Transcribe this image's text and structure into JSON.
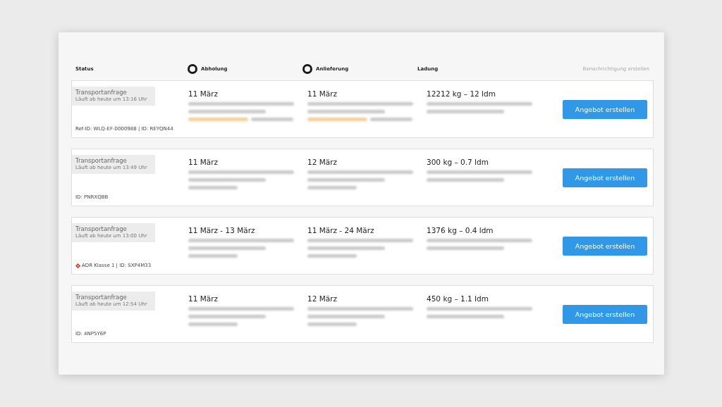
{
  "header": {
    "columns": [
      {
        "label": "Status",
        "kind": "plain"
      },
      {
        "label": "Abholung",
        "kind": "marker"
      },
      {
        "label": "Anlieferung",
        "kind": "marker"
      },
      {
        "label": "Ladung",
        "kind": "plain"
      }
    ],
    "action": "Benachrichtigung erstellen"
  },
  "requests": [
    {
      "status": "Transportanfrage",
      "expires": "Läuft ab heute um 13:16 Uhr",
      "hazard": false,
      "reference": "Ref-ID: WLQ-EF-0000988 | ID: REYQN44",
      "pickup": {
        "date": "11 März",
        "redacted_lines": [
          {
            "kind": "grey"
          },
          {
            "kind": "grey"
          },
          {
            "kind": "mixed"
          }
        ]
      },
      "delivery": {
        "date": "11 März",
        "redacted_lines": [
          {
            "kind": "grey"
          },
          {
            "kind": "grey"
          },
          {
            "kind": "mixed"
          }
        ]
      },
      "cargo": {
        "summary": "12212 kg – 12 ldm",
        "redacted_lines": [
          {
            "kind": "grey"
          },
          {
            "kind": "grey"
          }
        ]
      },
      "button": "Angebot erstellen"
    },
    {
      "status": "Transportanfrage",
      "expires": "Läuft ab heute um 13:49 Uhr",
      "hazard": false,
      "reference": "ID: PNRXQBB",
      "pickup": {
        "date": "11 März",
        "redacted_lines": [
          {
            "kind": "grey"
          },
          {
            "kind": "grey"
          },
          {
            "kind": "grey"
          }
        ]
      },
      "delivery": {
        "date": "12 März",
        "redacted_lines": [
          {
            "kind": "grey"
          },
          {
            "kind": "grey"
          },
          {
            "kind": "grey"
          }
        ]
      },
      "cargo": {
        "summary": "300 kg – 0.7 ldm",
        "redacted_lines": [
          {
            "kind": "grey"
          },
          {
            "kind": "grey"
          }
        ]
      },
      "button": "Angebot erstellen"
    },
    {
      "status": "Transportanfrage",
      "expires": "Läuft ab heute um 13:00 Uhr",
      "hazard": true,
      "reference": "ADR Klasse 1 | ID: SXP4M33",
      "pickup": {
        "date": "11 März - 13 März",
        "redacted_lines": [
          {
            "kind": "grey"
          },
          {
            "kind": "grey"
          },
          {
            "kind": "grey"
          }
        ]
      },
      "delivery": {
        "date": "11 März - 24 März",
        "redacted_lines": [
          {
            "kind": "grey"
          },
          {
            "kind": "grey"
          },
          {
            "kind": "grey"
          }
        ]
      },
      "cargo": {
        "summary": "1376 kg – 0.4 ldm",
        "redacted_lines": [
          {
            "kind": "grey"
          },
          {
            "kind": "grey"
          }
        ]
      },
      "button": "Angebot erstellen"
    },
    {
      "status": "Transportanfrage",
      "expires": "Läuft ab heute um 12:54 Uhr",
      "hazard": false,
      "reference": "ID: 4NP5Y6P",
      "pickup": {
        "date": "11 März",
        "redacted_lines": [
          {
            "kind": "grey"
          },
          {
            "kind": "grey"
          },
          {
            "kind": "grey"
          }
        ]
      },
      "delivery": {
        "date": "12 März",
        "redacted_lines": [
          {
            "kind": "grey"
          },
          {
            "kind": "grey"
          },
          {
            "kind": "grey"
          }
        ]
      },
      "cargo": {
        "summary": "450 kg – 1.1 ldm",
        "redacted_lines": [
          {
            "kind": "grey"
          },
          {
            "kind": "grey"
          }
        ]
      },
      "button": "Angebot erstellen"
    }
  ]
}
